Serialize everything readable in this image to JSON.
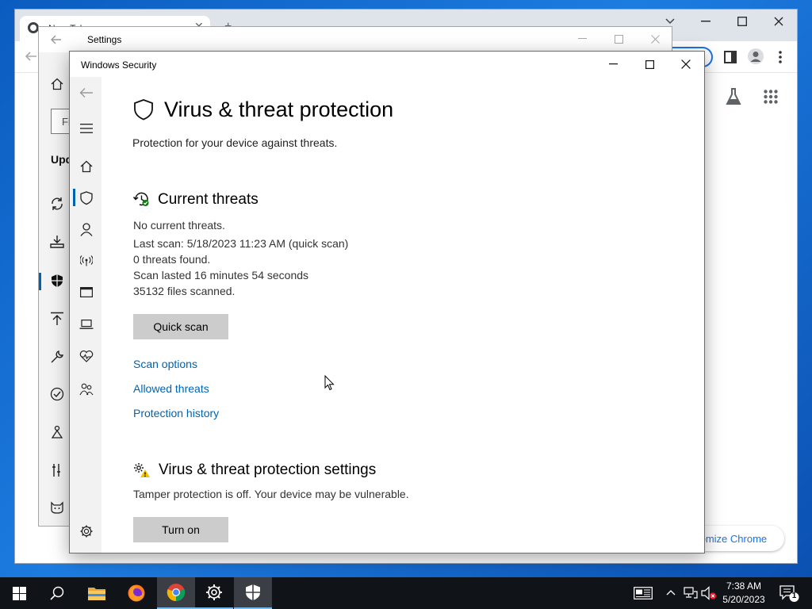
{
  "chrome": {
    "tab_title": "New Tab",
    "customize_label": "Customize Chrome",
    "customize_visible": "tomize Chrome"
  },
  "settings": {
    "title": "Settings",
    "search_placeholder": "Fi",
    "section_label": "Upd"
  },
  "winsec": {
    "title": "Windows Security",
    "page_title": "Virus & threat protection",
    "page_subtitle": "Protection for your device against threats.",
    "current_threats": {
      "heading": "Current threats",
      "lines": [
        "No current threats.",
        "Last scan: 5/18/2023 11:23 AM (quick scan)",
        "0 threats found.",
        "Scan lasted 16 minutes 54 seconds",
        "35132 files scanned."
      ],
      "quick_scan_label": "Quick scan",
      "links": [
        "Scan options",
        "Allowed threats",
        "Protection history"
      ]
    },
    "settings_section": {
      "heading": "Virus & threat protection settings",
      "message": "Tamper protection is off. Your device may be vulnerable.",
      "turn_on_label": "Turn on"
    },
    "nav_icons": [
      "back-icon",
      "hamburger-icon",
      "home-icon",
      "shield-icon",
      "account-icon",
      "firewall-icon",
      "app-browser-icon",
      "device-security-icon",
      "health-icon",
      "family-icon",
      "settings-gear-icon"
    ]
  },
  "taskbar": {
    "time": "7:38 AM",
    "date": "5/20/2023",
    "notification_count": "1"
  },
  "colors": {
    "accent": "#0063b1",
    "link": "#0063b1",
    "button_bg": "#cccccc",
    "taskbar_bg": "#101418",
    "desktop": "#1d7ce0"
  }
}
